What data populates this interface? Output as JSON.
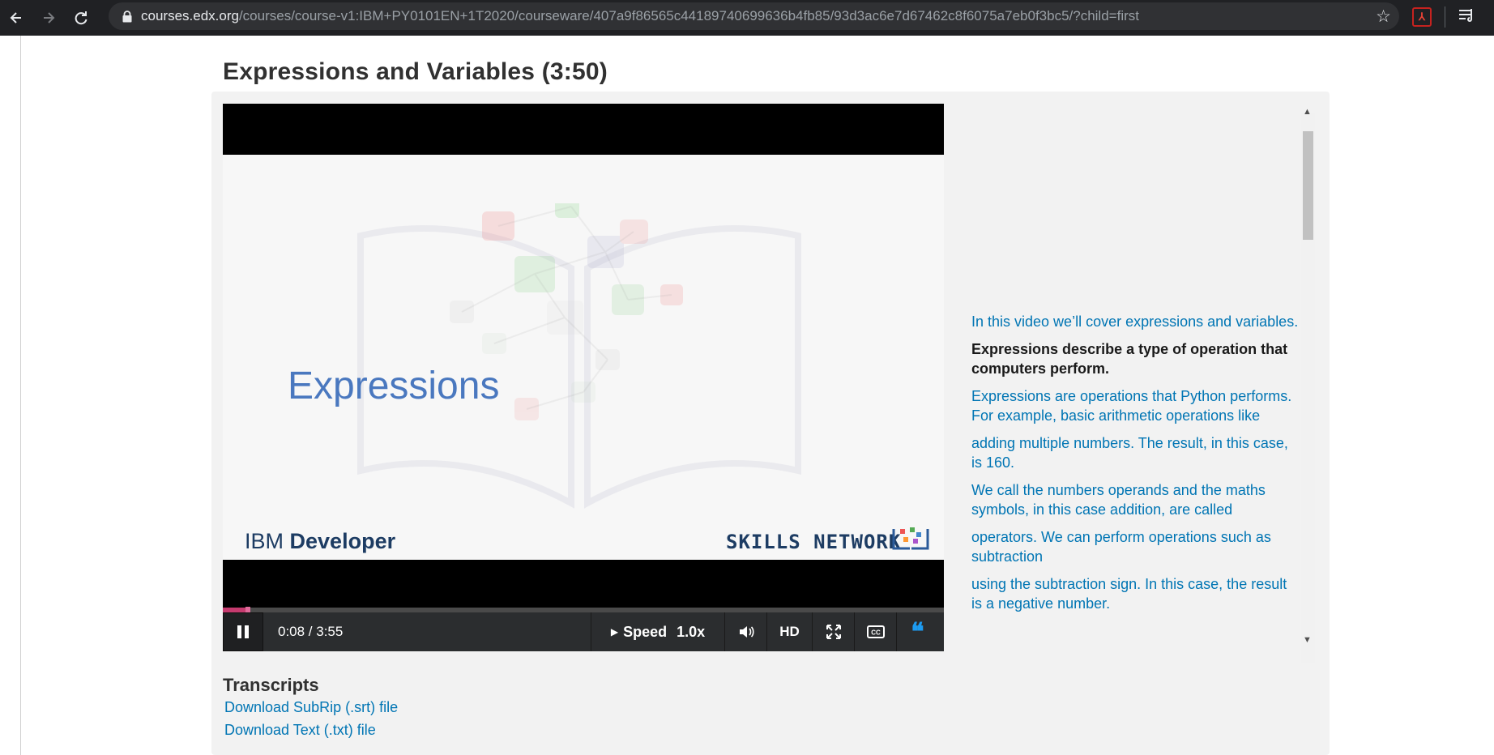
{
  "browser": {
    "url_host": "courses.edx.org",
    "url_path": "/courses/course-v1:IBM+PY0101EN+1T2020/courseware/407a9f86565c44189740699636b4fb85/93d3ac6e7d67462c8f6075a7eb0f3bc5/?child=first",
    "icons": [
      "back-icon",
      "forward-icon",
      "reload-icon",
      "lock-icon",
      "star-icon",
      "pdf-extension-icon",
      "reading-list-icon"
    ]
  },
  "page": {
    "title": "Expressions and Variables (3:50)"
  },
  "video": {
    "slide_title": "Expressions",
    "ibm_prefix": "IBM",
    "ibm_brand": "Developer",
    "skills_network": "SKILLS NETWORK",
    "progress_fraction": 0.035,
    "time_display": "0:08 / 3:55",
    "speed_label": "Speed",
    "speed_value": "1.0x",
    "hd_label": "HD",
    "progress_color": "#c63b6f",
    "transcript_toggle_color": "#1d9bf0"
  },
  "transcript": {
    "lines": [
      "In this video we’ll cover expressions and variables.",
      "Expressions describe a type of operation that computers perform.",
      "Expressions are operations that Python performs. For example, basic arithmetic operations like",
      "adding multiple numbers. The result, in this case, is 160.",
      "We call the numbers operands and the maths symbols, in this case addition, are called",
      "operators. We can perform operations such as subtraction",
      "using the subtraction sign. In this case, the result is a negative number."
    ],
    "current_index": 1,
    "link_color": "#0075b4"
  },
  "downloads": {
    "heading": "Transcripts",
    "srt_label": "Download SubRip (.srt) file",
    "txt_label": "Download Text (.txt) file"
  }
}
